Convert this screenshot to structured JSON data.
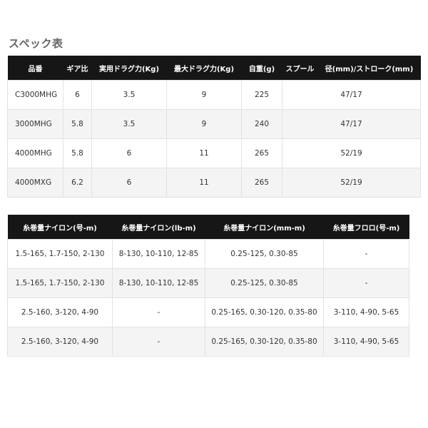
{
  "section_title": "スペック表",
  "spec_table": {
    "headers": [
      "品番",
      "ギア比",
      "実用ドラグ力(Kg)",
      "最大ドラグ力(Kg)",
      "自重(g)",
      "スプール",
      "径(mm)/ストローク(mm)"
    ],
    "rows": [
      [
        "C3000MHG",
        "6",
        "3.5",
        "9",
        "225",
        "47/17"
      ],
      [
        "3000MHG",
        "5.8",
        "3.5",
        "9",
        "240",
        "47/17"
      ],
      [
        "4000MHG",
        "5.8",
        "6",
        "11",
        "265",
        "52/19"
      ],
      [
        "4000MXG",
        "6.2",
        "6",
        "11",
        "265",
        "52/19"
      ]
    ]
  },
  "line_table": {
    "headers": [
      "糸巻量ナイロン(号-m)",
      "糸巻量ナイロン(lb-m)",
      "糸巻量ナイロン(mm-m)",
      "糸巻量フロロ(号-m)"
    ],
    "rows": [
      [
        "1.5-165, 1.7-150, 2-130",
        "8-130, 10-110, 12-85",
        "0.25-125, 0.30-85",
        "-"
      ],
      [
        "1.5-165, 1.7-150, 2-130",
        "8-130, 10-110, 12-85",
        "0.25-125, 0.30-85",
        "-"
      ],
      [
        "2.5-160, 3-120, 4-90",
        "-",
        "0.25-165, 0.30-120, 0.35-80",
        "3-110, 4-90, 5-65"
      ],
      [
        "2.5-160, 3-120, 4-90",
        "-",
        "0.25-165, 0.30-120, 0.35-80",
        "3-110, 4-90, 5-65"
      ]
    ]
  }
}
